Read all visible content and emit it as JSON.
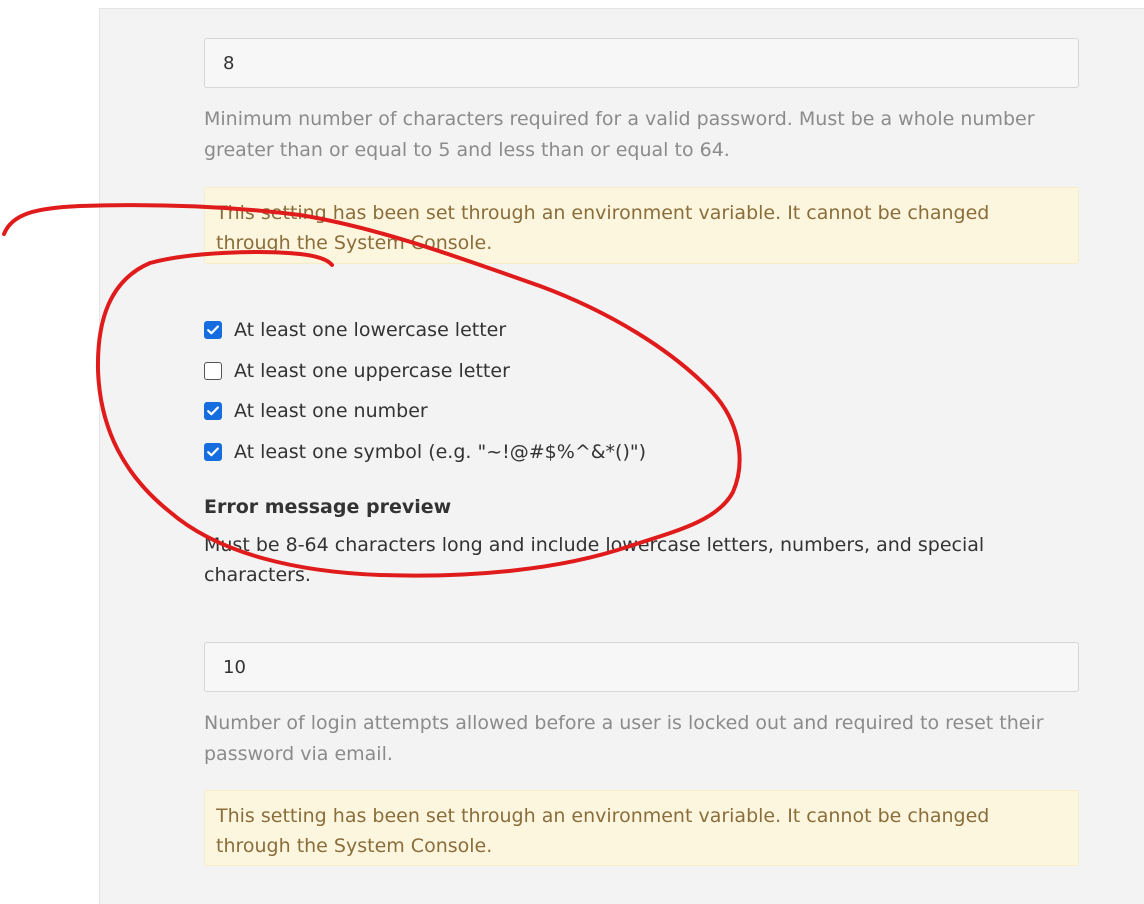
{
  "password_length": {
    "value": "8",
    "help": "Minimum number of characters required for a valid password. Must be a whole number greater than or equal to 5 and less than or equal to 64.",
    "env_warning": "This setting has been set through an environment variable. It cannot be changed through the System Console."
  },
  "password_requirements": {
    "options": [
      {
        "label": "At least one lowercase letter",
        "checked": true
      },
      {
        "label": "At least one uppercase letter",
        "checked": false
      },
      {
        "label": "At least one number",
        "checked": true
      },
      {
        "label": "At least one symbol (e.g. \"~!@#$%^&*()\")",
        "checked": true
      }
    ],
    "preview_title": "Error message preview",
    "preview_text": "Must be 8-64 characters long and include lowercase letters, numbers, and special characters."
  },
  "max_login_attempts": {
    "value": "10",
    "help": "Number of login attempts allowed before a user is locked out and required to reset their password via email.",
    "env_warning": "This setting has been set through an environment variable. It cannot be changed through the System Console."
  },
  "colors": {
    "checkbox_checked": "#166de0",
    "annotation_stroke": "#e01b1b",
    "warning_background": "#fdf6de",
    "warning_text": "#8a6d3b"
  }
}
